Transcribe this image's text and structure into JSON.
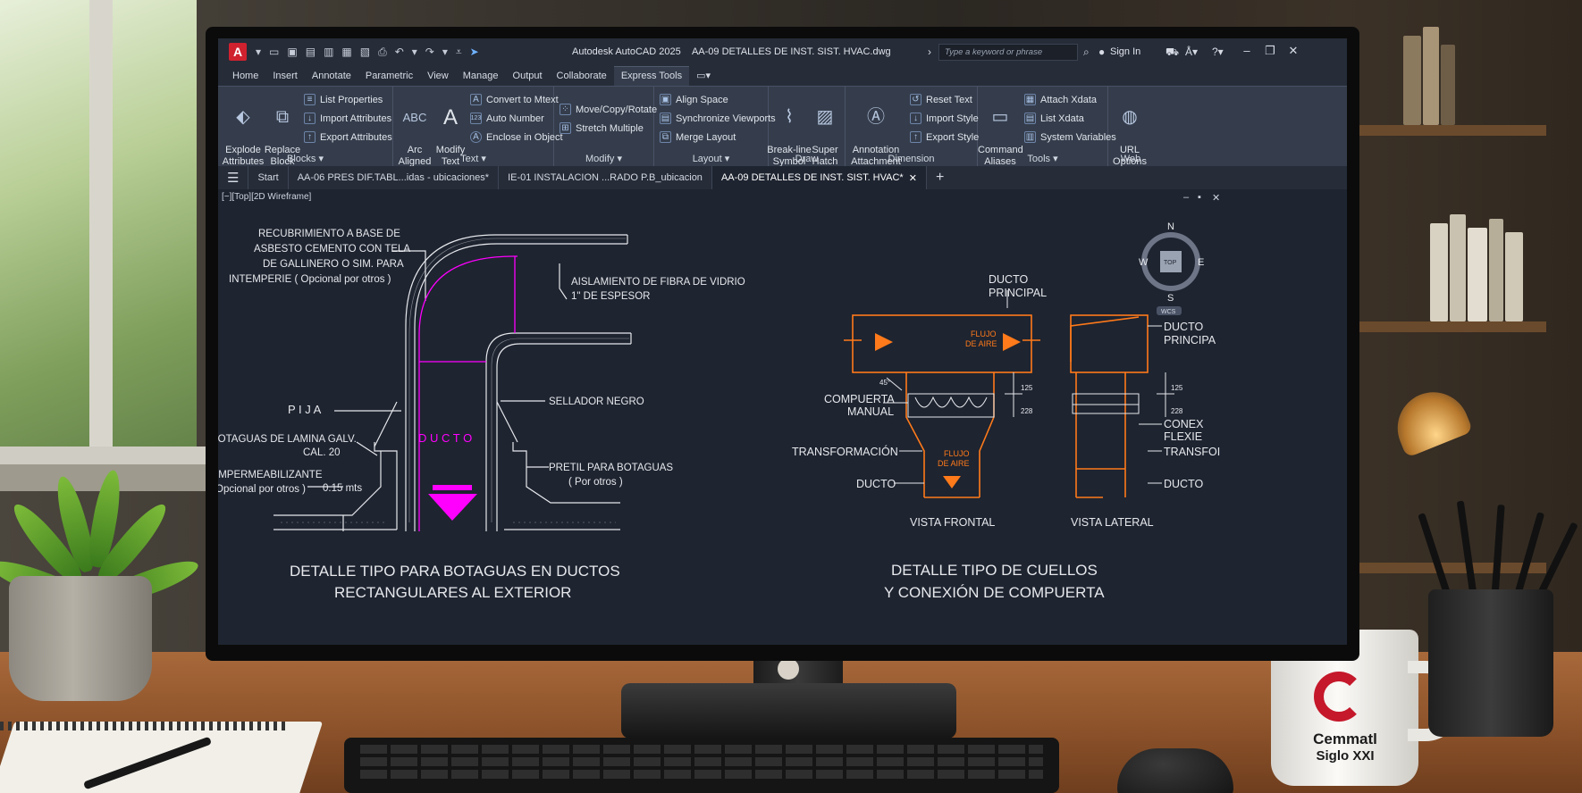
{
  "app": {
    "logo_letter": "A",
    "title": "Autodesk AutoCAD 2025",
    "filename": "AA-09 DETALLES DE INST. SIST. HVAC.dwg",
    "search_placeholder": "Type a keyword or phrase",
    "signin": "Sign In"
  },
  "ribbon_tabs": [
    "Home",
    "Insert",
    "Annotate",
    "Parametric",
    "View",
    "Manage",
    "Output",
    "Collaborate",
    "Express Tools"
  ],
  "active_ribbon_tab": "Express Tools",
  "ribbon": {
    "blocks": {
      "label": "Blocks",
      "explode": "Explode\nAttributes",
      "replace": "Replace\nBlock",
      "list_properties": "List Properties",
      "import_attributes": "Import Attributes",
      "export_attributes": "Export Attributes"
    },
    "text": {
      "label": "Text",
      "arc_aligned": "Arc\nAligned",
      "modify_text": "Modify\nText",
      "convert_mtext": "Convert to Mtext",
      "auto_number": "Auto Number",
      "enclose": "Enclose in Object"
    },
    "modify": {
      "label": "Modify",
      "move_copy_rotate": "Move/Copy/Rotate",
      "stretch_multiple": "Stretch Multiple"
    },
    "layout": {
      "label": "Layout",
      "align_space": "Align Space",
      "sync_viewports": "Synchronize Viewports",
      "merge_layout": "Merge Layout"
    },
    "draw": {
      "label": "Draw",
      "breakline": "Break-line\nSymbol",
      "super_hatch": "Super\nHatch"
    },
    "dimension": {
      "label": "Dimension",
      "annotation_attachment": "Annotation\nAttachment",
      "reset_text": "Reset Text",
      "import_style": "Import Style",
      "export_style": "Export Style"
    },
    "tools": {
      "label": "Tools",
      "command_aliases": "Command\nAliases",
      "attach_xdata": "Attach Xdata",
      "list_xdata": "List Xdata",
      "system_variables": "System Variables"
    },
    "web": {
      "label": "Web",
      "url_options": "URL\nOptions"
    }
  },
  "file_tabs": {
    "start": "Start",
    "tab1": "AA-06 PRES DIF.TABL...idas - ubicaciones*",
    "tab2": "IE-01 INSTALACION ...RADO P.B_ubicacion",
    "tab3": "AA-09 DETALLES DE INST. SIST. HVAC*"
  },
  "viewport_label": "[−][Top][2D Wireframe]",
  "viewcube": {
    "n": "N",
    "s": "S",
    "e": "E",
    "w": "W",
    "top": "TOP",
    "wcs": "WCS"
  },
  "detail_left": {
    "note_recubrimiento": [
      "RECUBRIMIENTO A BASE DE",
      "ASBESTO CEMENTO CON TELA",
      "DE GALLINERO O SIM. PARA",
      "INTEMPERIE ( Opcional por otros )"
    ],
    "note_aislamiento": [
      "AISLAMIENTO DE FIBRA DE VIDRIO",
      "1\" DE ESPESOR"
    ],
    "pija": "P I J A",
    "sellador": "SELLADOR NEGRO",
    "botaguas": [
      "BOTAGUAS DE LAMINA GALV.",
      "CAL. 20"
    ],
    "ducto": "D U C T O",
    "pretil": [
      "PRETIL PARA BOTAGUAS",
      "( Por otros )"
    ],
    "impermeabilizante": [
      "IMPERMEABILIZANTE",
      "Opcional por otros )"
    ],
    "dim": "0.15 mts",
    "caption": [
      "DETALLE TIPO PARA BOTAGUAS EN DUCTOS",
      "RECTANGULARES AL EXTERIOR"
    ]
  },
  "detail_right": {
    "ducto_principal": [
      "DUCTO",
      "PRINCIPAL"
    ],
    "ducto_principal_side": [
      "DUCTO",
      "PRINCIPA"
    ],
    "flujo_aire": [
      "FLUJO",
      "DE AIRE"
    ],
    "compuerta": [
      "COMPUERTA",
      "MANUAL"
    ],
    "transformacion": "TRANSFORMACIÓN",
    "ducto": "DUCTO",
    "conex": [
      "CONEX",
      "FLEXIE"
    ],
    "transfor_side": "TRANSFOI",
    "ducto_side": "DUCTO",
    "dim_125": "125",
    "dim_228": "228",
    "dim_45": "45°",
    "vista_frontal": "VISTA FRONTAL",
    "vista_lateral": "VISTA LATERAL",
    "caption": [
      "DETALLE TIPO DE CUELLOS",
      "Y CONEXIÓN DE COMPUERTA"
    ]
  },
  "mug": {
    "line1": "Cemmatl",
    "line2": "Siglo XXI"
  },
  "colors": {
    "magenta": "#ff00ff",
    "orange": "#ff7a1a",
    "white_line": "#e6e8ec",
    "cad_bg": "#1e2430",
    "brand_red": "#c5182a"
  }
}
